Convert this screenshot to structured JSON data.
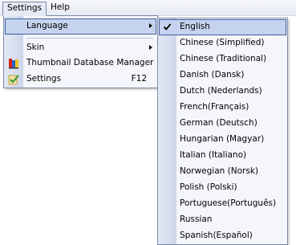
{
  "menubar": {
    "items": [
      {
        "label": "Settings"
      },
      {
        "label": "Help"
      }
    ]
  },
  "settings_menu": {
    "items": [
      {
        "label": "Language",
        "has_submenu": true,
        "highlighted": true,
        "icon": ""
      },
      {
        "label": "Skin",
        "has_submenu": true,
        "icon": ""
      },
      {
        "label": "Thumbnail Database Manager",
        "icon": "database-manager-icon"
      },
      {
        "label": "Settings",
        "shortcut": "F12",
        "icon": "settings-icon"
      }
    ]
  },
  "language_menu": {
    "selected": "English",
    "items": [
      {
        "label": "English",
        "checked": true
      },
      {
        "label": "Chinese (Simplified)"
      },
      {
        "label": "Chinese (Traditional)"
      },
      {
        "label": "Danish (Dansk)"
      },
      {
        "label": "Dutch (Nederlands)"
      },
      {
        "label": "French(Français)"
      },
      {
        "label": "German (Deutsch)"
      },
      {
        "label": "Hungarian (Magyar)"
      },
      {
        "label": "Italian (Italiano)"
      },
      {
        "label": "Norwegian (Norsk)"
      },
      {
        "label": "Polish (Polski)"
      },
      {
        "label": "Portuguese(Português)"
      },
      {
        "label": "Russian"
      },
      {
        "label": "Spanish(Español)"
      }
    ]
  },
  "colors": {
    "highlight_fill": "#c6d3ef",
    "highlight_border": "#3d5e9e",
    "menu_background": "#f4f6fb",
    "menu_border": "#7a8aa6"
  }
}
